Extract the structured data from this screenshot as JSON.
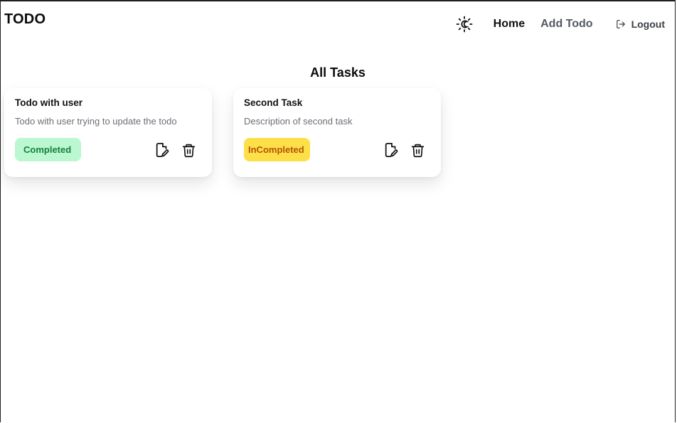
{
  "header": {
    "brand": "TODO",
    "nav": {
      "home": "Home",
      "add_todo": "Add Todo",
      "logout": "Logout"
    },
    "icons": {
      "theme": "sun-moon-icon",
      "logout": "logout-icon"
    }
  },
  "main": {
    "title": "All Tasks",
    "tasks": [
      {
        "title": "Todo with user",
        "description": "Todo with user trying to update the todo",
        "status": "Completed",
        "status_color": "#15803d",
        "status_bg": "#bbf7d0"
      },
      {
        "title": "Second Task",
        "description": "Description of second task",
        "status": "InCompleted",
        "status_color": "#b45309",
        "status_bg": "#fde047"
      }
    ],
    "task_icons": {
      "edit": "edit-file-icon",
      "delete": "trash-icon"
    }
  }
}
